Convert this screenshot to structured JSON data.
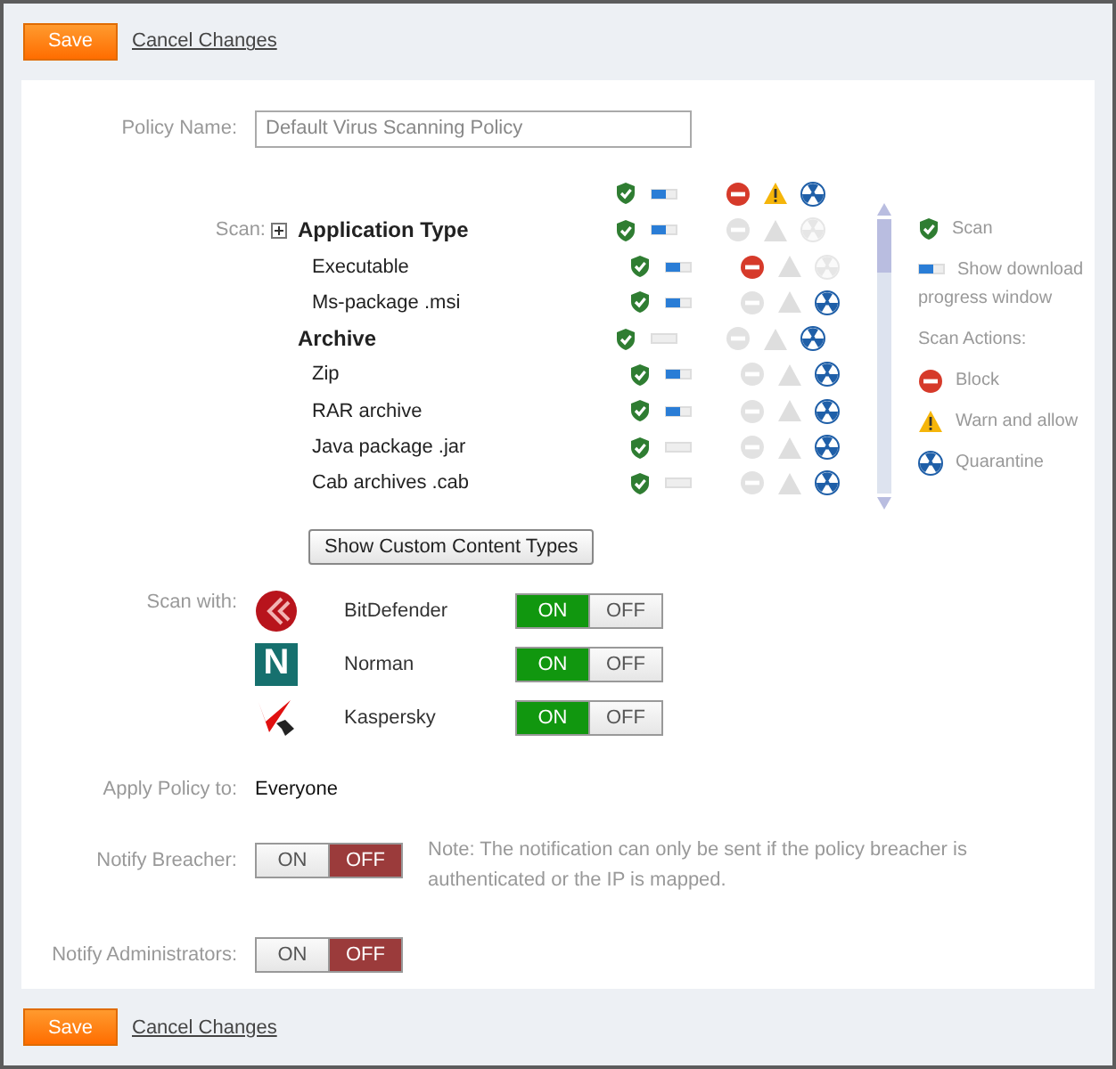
{
  "top_actions": {
    "save": "Save",
    "cancel": "Cancel Changes"
  },
  "policy_name": {
    "label": "Policy Name:",
    "value": "Default Virus Scanning Policy"
  },
  "scan": {
    "label": "Scan:",
    "rows": [
      {
        "kind": "group",
        "name": "Application Type",
        "progress": true,
        "block": false,
        "warn": false,
        "quarantine": false
      },
      {
        "kind": "type",
        "name": "Executable",
        "progress": true,
        "block": true,
        "warn": false,
        "quarantine": false
      },
      {
        "kind": "type",
        "name": "Ms-package .msi",
        "progress": true,
        "block": false,
        "warn": false,
        "quarantine": true
      },
      {
        "kind": "group",
        "name": "Archive",
        "progress": false,
        "block": false,
        "warn": false,
        "quarantine": true
      },
      {
        "kind": "type",
        "name": "Zip",
        "progress": true,
        "block": false,
        "warn": false,
        "quarantine": true
      },
      {
        "kind": "type",
        "name": "RAR archive",
        "progress": true,
        "block": false,
        "warn": false,
        "quarantine": true
      },
      {
        "kind": "type",
        "name": "Java package .jar",
        "progress": false,
        "block": false,
        "warn": false,
        "quarantine": true
      },
      {
        "kind": "type",
        "name": "Cab archives .cab",
        "progress": false,
        "block": false,
        "warn": false,
        "quarantine": true
      }
    ],
    "legend": [
      {
        "kind": "shield",
        "text": "Scan"
      },
      {
        "kind": "progress",
        "text": "Show download progress window"
      },
      {
        "kind": "heading",
        "text": "Scan Actions:"
      },
      {
        "kind": "block",
        "text": "Block"
      },
      {
        "kind": "warn",
        "text": "Warn and allow"
      },
      {
        "kind": "quarantine",
        "text": "Quarantine"
      }
    ],
    "button": "Show Custom Content Types"
  },
  "scan_with": {
    "label": "Scan with:",
    "engines": [
      {
        "kind": "sphere",
        "name": "BitDefender",
        "on": true,
        "on_label": "ON",
        "off_label": "OFF"
      },
      {
        "kind": "letter",
        "logo_text": "N",
        "name": "Norman",
        "on": true,
        "on_label": "ON",
        "off_label": "OFF"
      },
      {
        "kind": "swoosh",
        "name": "Kaspersky",
        "on": true,
        "on_label": "ON",
        "off_label": "OFF"
      }
    ]
  },
  "apply_policy": {
    "label": "Apply Policy to:",
    "value": "Everyone"
  },
  "notify_breacher": {
    "label": "Notify Breacher:",
    "on": false,
    "on_label": "ON",
    "off_label": "OFF",
    "note": "Note: The notification can only be sent if the policy breacher is authenticated or the IP is mapped."
  },
  "notify_admins": {
    "label": "Notify Administrators:",
    "on": false,
    "on_label": "ON",
    "off_label": "OFF"
  },
  "bottom_actions": {
    "save": "Save",
    "cancel": "Cancel Changes"
  }
}
